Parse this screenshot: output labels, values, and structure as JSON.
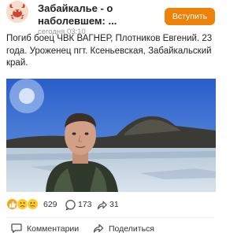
{
  "header": {
    "group_name": "Забайкалье - о наболевшем: ...",
    "post_date": "сегодня 03:10",
    "join_label": "Вступить"
  },
  "post": {
    "text": "Погиб боец ЧВК ВАГНЕР, Плотников Евгений. 23 года. Уроженец пгт. Ксеньевская, Забайкальский край."
  },
  "photo": {
    "icon": "selfie-photo"
  },
  "stats": {
    "reactions_count": "629",
    "comments_count": "173",
    "shares_count": "31",
    "reaction_icons": [
      "like-reaction-icon",
      "sad-reaction-icon",
      "cry-reaction-icon"
    ]
  },
  "actions": {
    "comments_label": "Комментарии",
    "share_label": "Поделиться"
  },
  "colors": {
    "accent": "#ee8208",
    "text": "#222222",
    "muted": "#9a9a9a"
  }
}
